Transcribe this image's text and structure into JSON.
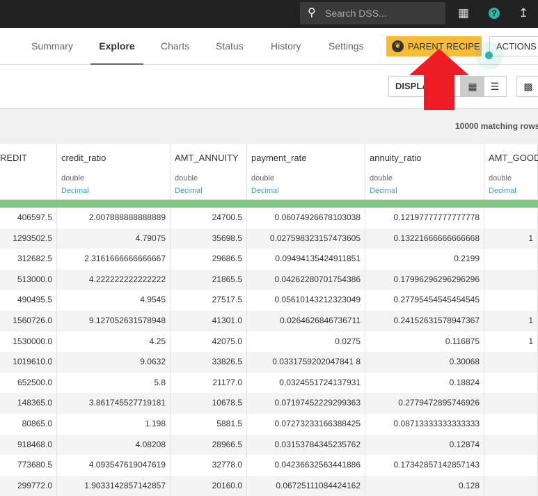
{
  "topbar": {
    "search_placeholder": "Search DSS...",
    "icons": [
      "search-icon",
      "apps-grid-icon",
      "help-icon",
      "activity-trend-icon"
    ]
  },
  "tabs": [
    {
      "label": "Summary"
    },
    {
      "label": "Explore",
      "active": true
    },
    {
      "label": "Charts"
    },
    {
      "label": "Status"
    },
    {
      "label": "History"
    },
    {
      "label": "Settings"
    }
  ],
  "buttons": {
    "parent_recipe": "PARENT RECIPE",
    "actions": "ACTIONS",
    "display": "DISPLA"
  },
  "colors": {
    "accent": "#f8bb35",
    "teal": "#2bb5a8",
    "arrow": "#ee1c24",
    "valid": "#80c784"
  },
  "table": {
    "matching": "10000 matching rows",
    "columns": [
      {
        "name": "REDIT",
        "type": "",
        "meaning": ""
      },
      {
        "name": "credit_ratio",
        "type": "double",
        "meaning": "Decimal"
      },
      {
        "name": "AMT_ANNUITY",
        "type": "double",
        "meaning": "Decimal"
      },
      {
        "name": "payment_rate",
        "type": "double",
        "meaning": "Decimal"
      },
      {
        "name": "annuity_ratio",
        "type": "double",
        "meaning": "Decimal"
      },
      {
        "name": "AMT_GOODS",
        "type": "double",
        "meaning": "Decimal"
      }
    ],
    "rows": [
      [
        "406597.5",
        "2.007888888888889",
        "24700.5",
        "0.06074926678103038",
        "0.12197777777777778",
        ""
      ],
      [
        "1293502.5",
        "4.79075",
        "35698.5",
        "0.027598323157473605",
        "0.13221666666666668",
        "1"
      ],
      [
        "312682.5",
        "2.3161666666666667",
        "29686.5",
        "0.09494135424911851",
        "0.2199",
        ""
      ],
      [
        "513000.0",
        "4.222222222222222",
        "21865.5",
        "0.04262280701754386",
        "0.17996296296296296",
        ""
      ],
      [
        "490495.5",
        "4.9545",
        "27517.5",
        "0.05610143212323049",
        "0.27795454545454545",
        ""
      ],
      [
        "1560726.0",
        "9.127052631578948",
        "41301.0",
        "0.0264626846736711",
        "0.24152631578947367",
        "1"
      ],
      [
        "1530000.0",
        "4.25",
        "42075.0",
        "0.0275",
        "0.116875",
        "1"
      ],
      [
        "1019610.0",
        "9.0632",
        "33826.5",
        "0.0331759202047841 8",
        "0.30068",
        ""
      ],
      [
        "652500.0",
        "5.8",
        "21177.0",
        "0.0324551724137931",
        "0.18824",
        ""
      ],
      [
        "148365.0",
        "3.861745527719181",
        "10678.5",
        "0.07197452229299363",
        "0.2779472895746926",
        ""
      ],
      [
        "80865.0",
        "1.198",
        "5881.5",
        "0.07273233166388425",
        "0.08713333333333333",
        ""
      ],
      [
        "918468.0",
        "4.08208",
        "28966.5",
        "0.03153784345235762",
        "0.12874",
        ""
      ],
      [
        "773680.5",
        "4.093547619047619",
        "32778.0",
        "0.04236632563441886",
        "0.17342857142857143",
        ""
      ],
      [
        "299772.0",
        "1.9033142857142857",
        "20160.0",
        "0.06725111084424162",
        "0.128",
        ""
      ]
    ]
  }
}
